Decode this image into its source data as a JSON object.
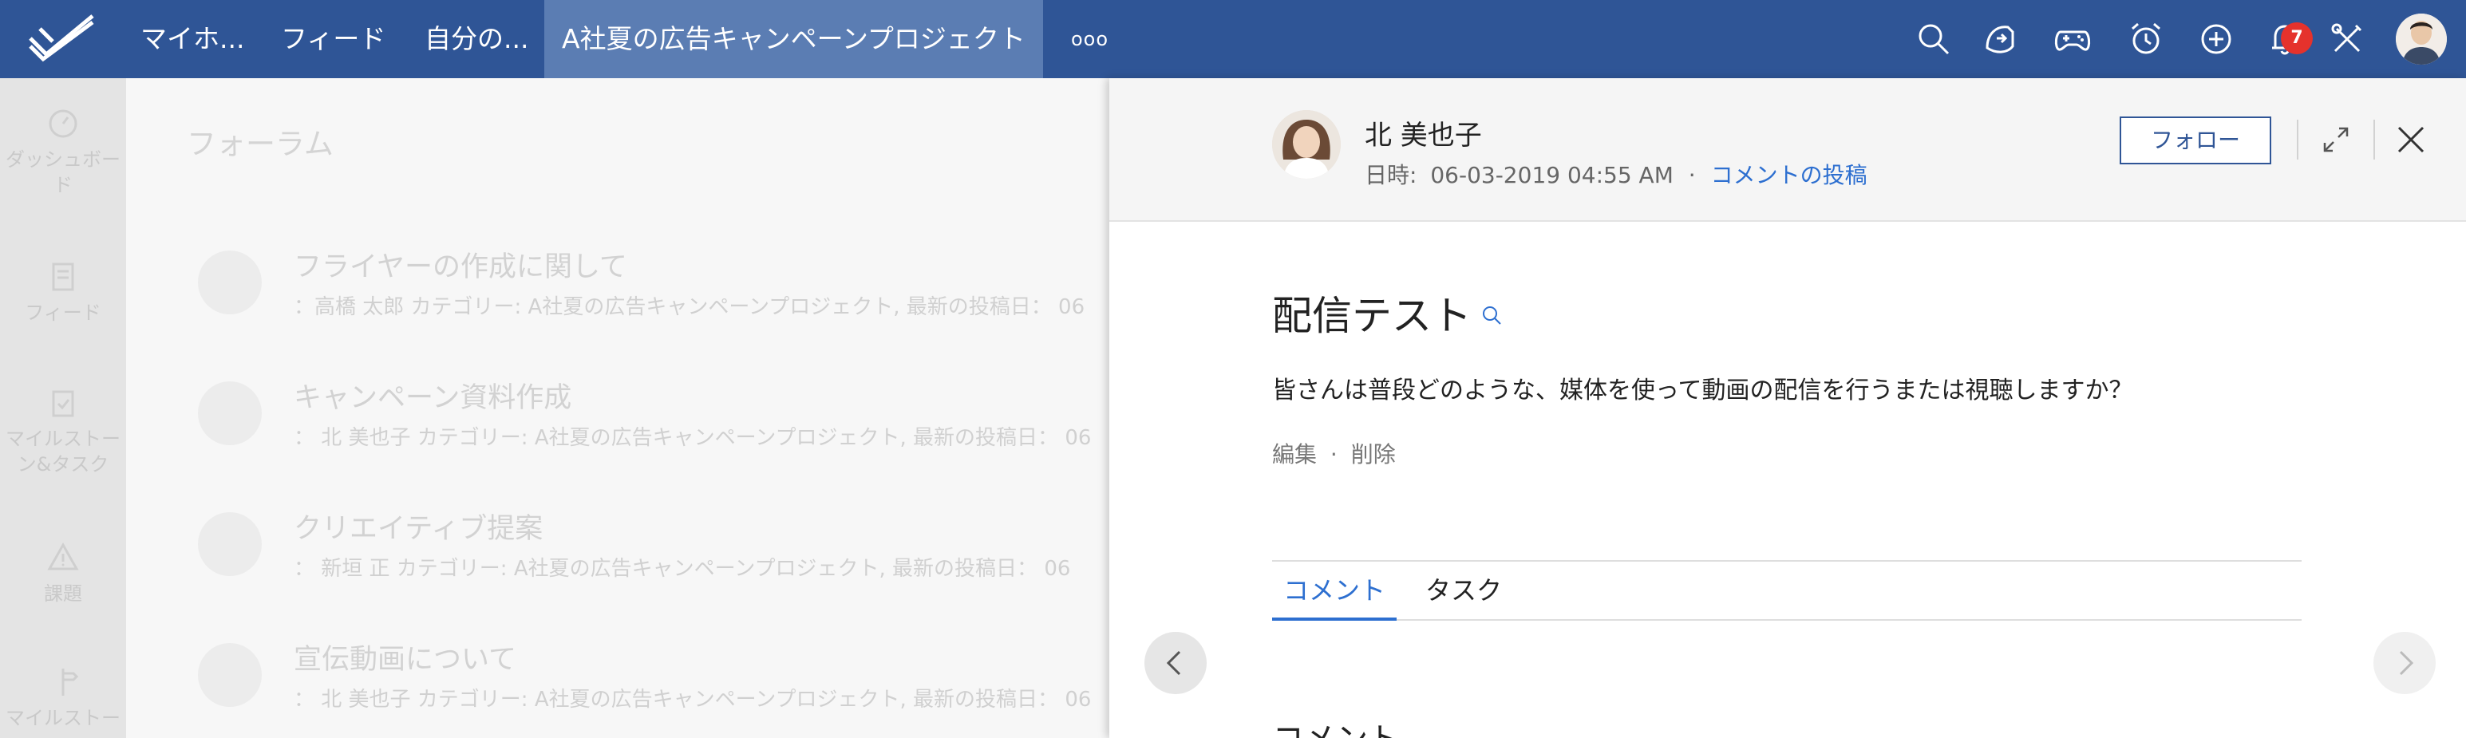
{
  "topbar": {
    "nav": [
      "マイホ...",
      "フィード",
      "自分の...",
      "A社夏の広告キャンペーンプロジェクト"
    ],
    "more_label": "ooo",
    "notification_count": "7",
    "icons": [
      "search-icon",
      "handshake-icon",
      "gamepad-icon",
      "alarm-clock-icon",
      "add-circle-icon",
      "bell-icon",
      "tools-icon"
    ]
  },
  "sidebar": {
    "items": [
      "ダッシュボード",
      "フィード",
      "マイルストーン&タスク",
      "課題",
      "マイルストー"
    ]
  },
  "main": {
    "title": "フォーラム",
    "threads": [
      {
        "title": "フライヤーの作成に関して",
        "meta": "：高橋 太郎  カテゴリー: A社夏の広告キャンペーンプロジェクト,  最新の投稿日： 06"
      },
      {
        "title": "キャンペーン資料作成",
        "meta": "： 北 美也子 カテゴリー: A社夏の広告キャンペーンプロジェクト,  最新の投稿日： 06"
      },
      {
        "title": "クリエイティブ提案",
        "meta": "：  新垣  正   カテゴリー: A社夏の広告キャンペーンプロジェクト,  最新の投稿日： 06"
      },
      {
        "title": "宣伝動画について",
        "meta": "： 北 美也子 カテゴリー: A社夏の広告キャンペーンプロジェクト,  最新の投稿日： 06"
      }
    ]
  },
  "panel": {
    "author": "北 美也子",
    "date_label": "日時:",
    "date": "06-03-2019 04:55 AM",
    "meta_dot": "·",
    "meta_link": "コメントの投稿",
    "follow_label": "フォロー",
    "post_title": "配信テスト",
    "post_body": "皆さんは普段どのような、媒体を使って動画の配信を行うまたは視聴しますか？",
    "edit_label": "編集",
    "action_sep": "·",
    "delete_label": "削除",
    "tabs": [
      "コメント",
      "タスク"
    ],
    "section_heading": "コメント"
  },
  "colors": {
    "topbar": "#2f5596",
    "active_tab_bg": "#5b7db3",
    "link": "#2d6fd0",
    "badge": "#e5322c"
  }
}
